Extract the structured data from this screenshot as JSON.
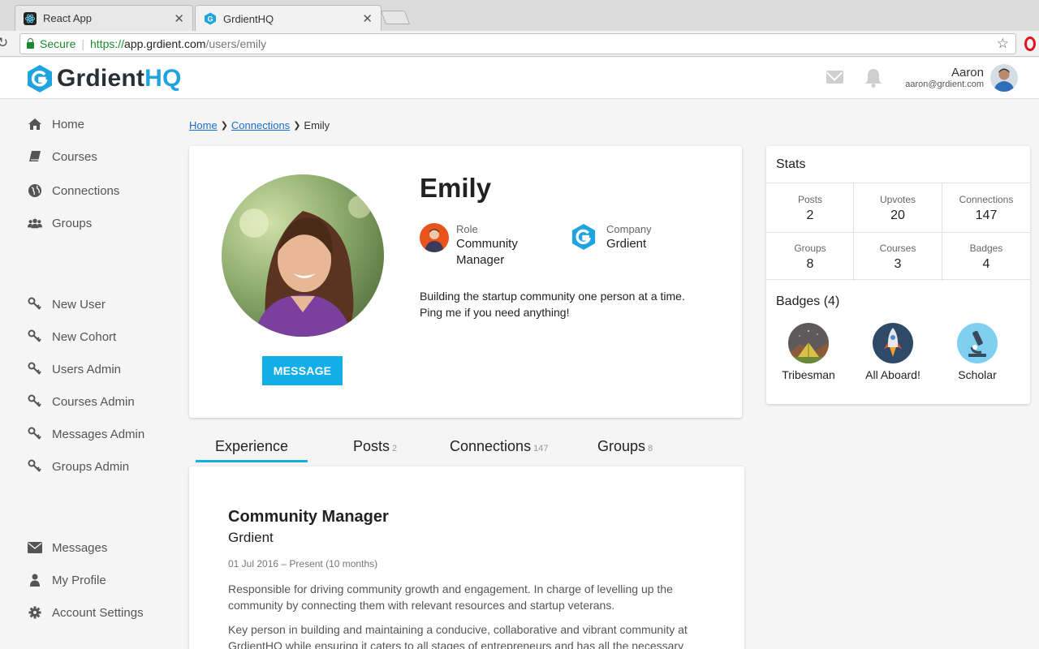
{
  "browser": {
    "tabs": [
      {
        "title": "React App"
      },
      {
        "title": "GrdientHQ"
      }
    ],
    "secure_label": "Secure",
    "url_scheme": "https://",
    "url_host": "app.grdient.com",
    "url_path": "/users/emily"
  },
  "header": {
    "logo_text": "Grdient",
    "logo_text_accent": "HQ",
    "user_name": "Aaron",
    "user_email": "aaron@grdient.com"
  },
  "sidebar": {
    "primary": [
      {
        "label": "Home",
        "icon": "home-icon"
      },
      {
        "label": "Courses",
        "icon": "book-icon"
      },
      {
        "label": "Connections",
        "icon": "globe-icon"
      },
      {
        "label": "Groups",
        "icon": "users-icon"
      }
    ],
    "admin": [
      {
        "label": "New User",
        "icon": "key-icon"
      },
      {
        "label": "New Cohort",
        "icon": "key-icon"
      },
      {
        "label": "Users Admin",
        "icon": "key-icon"
      },
      {
        "label": "Courses Admin",
        "icon": "key-icon"
      },
      {
        "label": "Messages Admin",
        "icon": "key-icon"
      },
      {
        "label": "Groups Admin",
        "icon": "key-icon"
      }
    ],
    "account": [
      {
        "label": "Messages",
        "icon": "envelope-icon"
      },
      {
        "label": "My Profile",
        "icon": "user-icon"
      },
      {
        "label": "Account Settings",
        "icon": "gear-icon"
      }
    ]
  },
  "breadcrumb": {
    "home": "Home",
    "connections": "Connections",
    "current": "Emily"
  },
  "profile": {
    "name": "Emily",
    "message_button": "MESSAGE",
    "role_label": "Role",
    "role_value": "Community Manager",
    "company_label": "Company",
    "company_value": "Grdient",
    "bio_line1": "Building the startup community one person at a time.",
    "bio_line2": "Ping me if you need anything!"
  },
  "stats": {
    "title": "Stats",
    "items": [
      {
        "label": "Posts",
        "value": "2"
      },
      {
        "label": "Upvotes",
        "value": "20"
      },
      {
        "label": "Connections",
        "value": "147"
      },
      {
        "label": "Groups",
        "value": "8"
      },
      {
        "label": "Courses",
        "value": "3"
      },
      {
        "label": "Badges",
        "value": "4"
      }
    ],
    "badges_title": "Badges (4)",
    "badges": [
      {
        "label": "Tribesman",
        "icon": "tent-icon"
      },
      {
        "label": "All Aboard!",
        "icon": "rocket-icon"
      },
      {
        "label": "Scholar",
        "icon": "microscope-icon"
      }
    ]
  },
  "tabs": [
    {
      "label": "Experience",
      "count": ""
    },
    {
      "label": "Posts",
      "count": "2"
    },
    {
      "label": "Connections",
      "count": "147"
    },
    {
      "label": "Groups",
      "count": "8"
    }
  ],
  "experience": {
    "title": "Community Manager",
    "company": "Grdient",
    "dates": "01 Jul 2016 – Present (10 months)",
    "desc1": "Responsible for driving community growth and engagement. In charge of levelling up the community by connecting them with relevant resources and startup veterans.",
    "desc2": "Key person in building and maintaining a conducive, collaborative and vibrant community at GrdientHQ while ensuring it caters to all stages of entrepreneurs and has all the necessary"
  },
  "colors": {
    "accent": "#11aee8",
    "link": "#1a6fd0",
    "secure": "#1a8a2e"
  }
}
